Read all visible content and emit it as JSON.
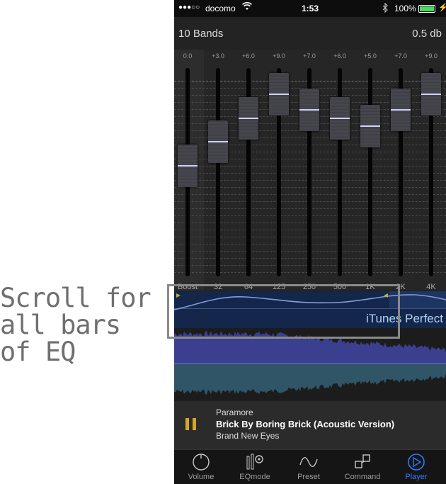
{
  "callout": {
    "line1": "Scroll for",
    "line2": "all bars of EQ"
  },
  "status_bar": {
    "signal": "●●●○○",
    "carrier": "docomo",
    "time": "1:53",
    "battery_percent": "100%"
  },
  "header": {
    "bands_label": "10 Bands",
    "db_label": "0.5 db"
  },
  "eq": {
    "bands": [
      {
        "freq": "Boost",
        "gain": "0.0",
        "value": 0.0
      },
      {
        "freq": "32",
        "gain": "+3.0",
        "value": 3.0
      },
      {
        "freq": "64",
        "gain": "+6.0",
        "value": 6.0
      },
      {
        "freq": "125",
        "gain": "+9.0",
        "value": 9.0
      },
      {
        "freq": "250",
        "gain": "+7.0",
        "value": 7.0
      },
      {
        "freq": "500",
        "gain": "+6.0",
        "value": 6.0
      },
      {
        "freq": "1K",
        "gain": "+5.0",
        "value": 5.0
      },
      {
        "freq": "2K",
        "gain": "+7.0",
        "value": 7.0
      },
      {
        "freq": "4K",
        "gain": "+9.0",
        "value": 9.0
      }
    ],
    "gain_range": [
      -12,
      12
    ]
  },
  "curve": {
    "preset_name": "iTunes Perfect"
  },
  "now_playing": {
    "artist": "Paramore",
    "title": "Brick By Boring Brick (Acoustic Version)",
    "album": "Brand New Eyes"
  },
  "tabs": [
    {
      "label": "Volume",
      "icon": "volume-knob-icon"
    },
    {
      "label": "EQmode",
      "icon": "eqmode-icon"
    },
    {
      "label": "Preset",
      "icon": "preset-wave-icon"
    },
    {
      "label": "Command",
      "icon": "command-icon"
    },
    {
      "label": "Player",
      "icon": "player-icon",
      "active": true
    }
  ],
  "colors": {
    "accent_blue": "#2f7bff",
    "pause_gold": "#d4a62a",
    "curve_bg": "#14264a",
    "preset_text": "#aed4ff",
    "battery_green": "#4cd964"
  }
}
